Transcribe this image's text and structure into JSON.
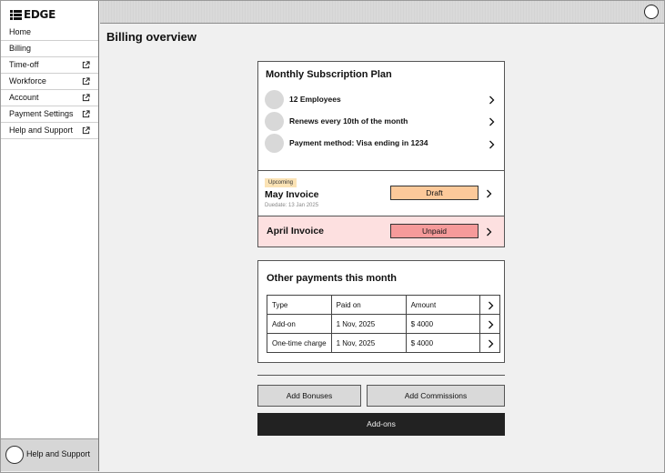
{
  "app": {
    "logo_text": "EDGE"
  },
  "sidebar": {
    "items": [
      {
        "label": "Home",
        "external": false
      },
      {
        "label": "Billing",
        "external": false
      },
      {
        "label": "Time-off",
        "external": true
      },
      {
        "label": "Workforce",
        "external": true
      },
      {
        "label": "Account",
        "external": true
      },
      {
        "label": "Payment Settings",
        "external": true
      },
      {
        "label": "Help and Support",
        "external": true
      }
    ],
    "footer_label": "Help and Support"
  },
  "page": {
    "title": "Billing overview"
  },
  "subscription": {
    "title": "Monthly Subscription Plan",
    "rows": [
      {
        "label": "12 Employees"
      },
      {
        "label": "Renews every 10th of the month"
      },
      {
        "label": "Payment method: Visa ending in 1234"
      }
    ]
  },
  "invoices": {
    "may": {
      "badge": "Upcoming",
      "name": "May Invoice",
      "due": "Duedate: 13 Jan 2025",
      "status": "Draft"
    },
    "april": {
      "name": "April Invoice",
      "status": "Unpaid"
    }
  },
  "other_payments": {
    "title": "Other payments this month",
    "headers": [
      "Type",
      "Paid on",
      "Amount"
    ],
    "rows": [
      [
        "Add-on",
        "1 Nov, 2025",
        "$ 4000"
      ],
      [
        "One-time charge",
        "1 Nov, 2025",
        "$ 4000"
      ]
    ]
  },
  "actions": {
    "add_bonuses": "Add Bonuses",
    "add_commissions": "Add Commissions",
    "add_ons": "Add-ons"
  },
  "colors": {
    "draft_status": "#fcc99a",
    "unpaid_status": "#f59a9a",
    "april_row_bg": "#fde0e0",
    "upcoming_badge": "#fbe3b5",
    "primary_button": "#222222"
  },
  "icons": {
    "external": "external-link-icon",
    "chevron": "chevron-right-icon",
    "avatar": "avatar-icon"
  }
}
